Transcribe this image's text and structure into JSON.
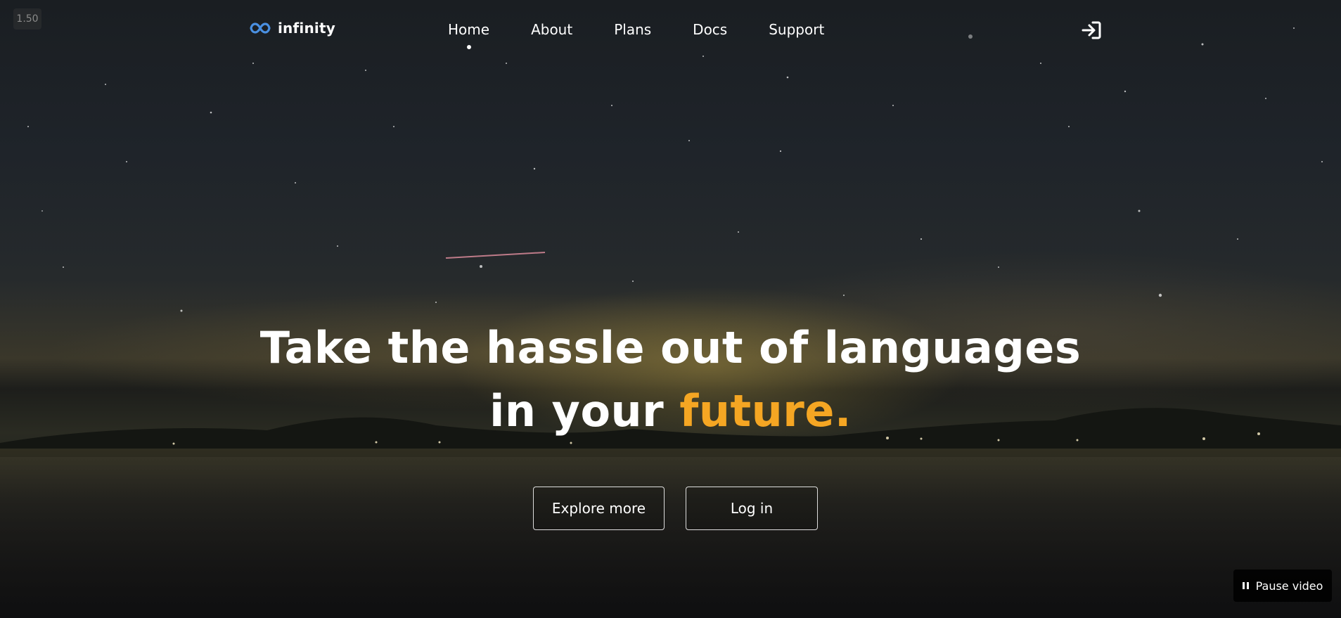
{
  "video": {
    "timestamp": "1.50",
    "pause_label": "Pause video"
  },
  "brand": {
    "name": "infinity",
    "logo_icon": "infinity-icon",
    "logo_color": "#4a90e2"
  },
  "nav": {
    "items": [
      {
        "label": "Home",
        "active": true
      },
      {
        "label": "About",
        "active": false
      },
      {
        "label": "Plans",
        "active": false
      },
      {
        "label": "Docs",
        "active": false
      },
      {
        "label": "Support",
        "active": false
      }
    ],
    "login_icon": "sign-in-icon"
  },
  "hero": {
    "line1": "Take the hassle out of languages",
    "line2_prefix": "in your ",
    "line2_accent": "future.",
    "accent_color": "#f5a623"
  },
  "cta": {
    "explore_label": "Explore more",
    "login_label": "Log in"
  }
}
